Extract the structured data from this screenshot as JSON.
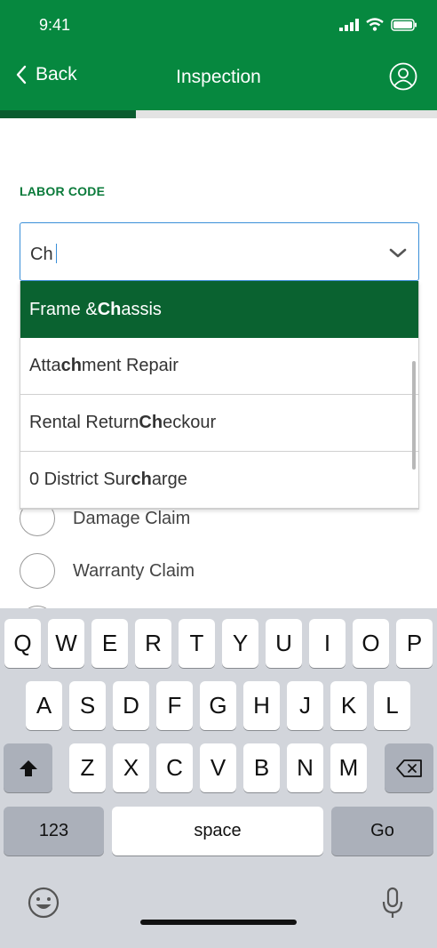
{
  "status": {
    "time": "9:41"
  },
  "nav": {
    "back_label": "Back",
    "title": "Inspection"
  },
  "progress": {
    "fraction": 0.31
  },
  "field": {
    "label": "LABOR CODE",
    "value": "Ch"
  },
  "dropdown": {
    "options": [
      {
        "pre": "Frame & ",
        "match": "Ch",
        "post": "assis",
        "selected": true
      },
      {
        "pre": "Atta",
        "match": "ch",
        "post": "ment Repair",
        "selected": false
      },
      {
        "pre": "Rental Return ",
        "match": "Ch",
        "post": "eckour",
        "selected": false
      },
      {
        "pre": "0 District Sur",
        "match": "ch",
        "post": "arge",
        "selected": false
      }
    ]
  },
  "radios": [
    {
      "label": "Damage Claim"
    },
    {
      "label": "Warranty Claim"
    }
  ],
  "keyboard": {
    "row1": [
      "Q",
      "W",
      "E",
      "R",
      "T",
      "Y",
      "U",
      "I",
      "O",
      "P"
    ],
    "row2": [
      "A",
      "S",
      "D",
      "F",
      "G",
      "H",
      "J",
      "K",
      "L"
    ],
    "row3": [
      "Z",
      "X",
      "C",
      "V",
      "B",
      "N",
      "M"
    ],
    "numbers_label": "123",
    "space_label": "space",
    "go_label": "Go"
  },
  "colors": {
    "brand": "#06883f",
    "selected": "#0a6230",
    "focus": "#3a8fd8"
  }
}
